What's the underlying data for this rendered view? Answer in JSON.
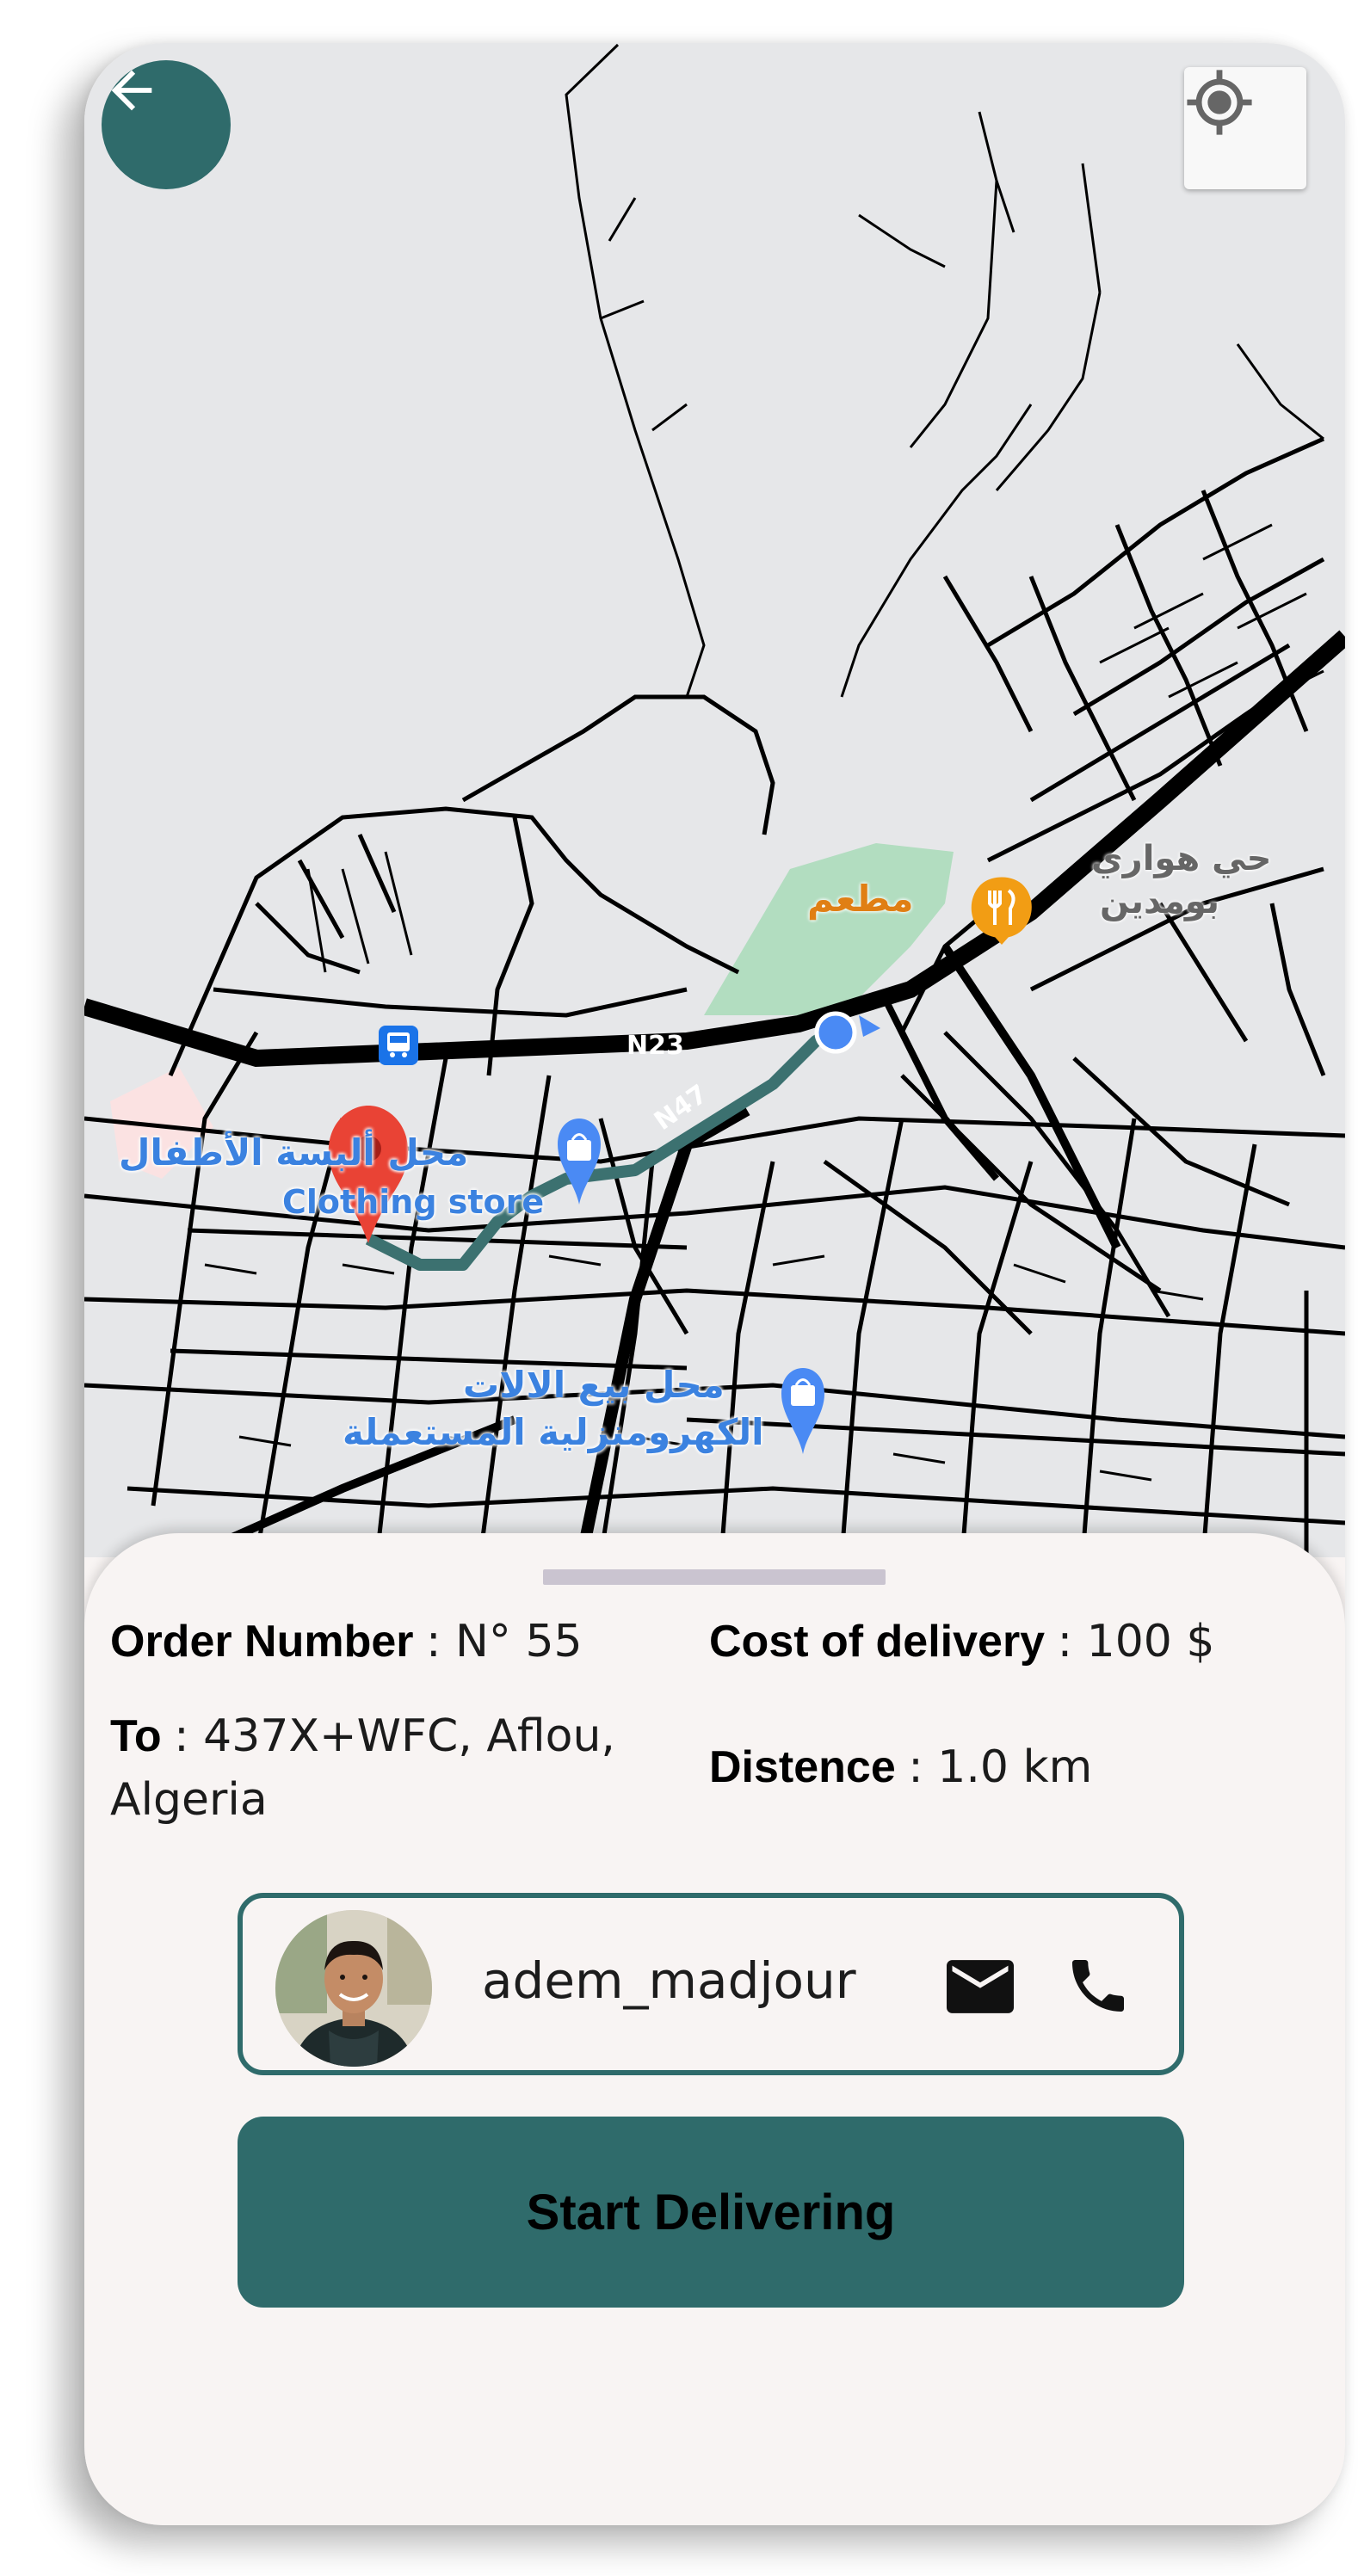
{
  "map": {
    "labels": {
      "clothing_ar": "محل ألبسة الأطفال",
      "clothing_en": "Clothing store",
      "restaurant_ar": "مطعم",
      "district_ar_1": "حي هواري",
      "district_ar_2": "بومدين",
      "electronics_ar_1": "محل بيع الالات",
      "electronics_ar_2": "الكهرومنزلية المستعملة",
      "road_n23": "N23",
      "road_n47": "N47"
    },
    "icons": {
      "back": "arrow-left-icon",
      "locate": "my-location-icon",
      "destination": "map-pin-icon",
      "shopping": "shopping-bag-icon",
      "restaurant": "restaurant-icon",
      "bus": "bus-icon"
    },
    "colors": {
      "route": "#3c7170",
      "pin": "#e94335",
      "poi_blue": "#4a8af4",
      "poi_orange": "#f29d14",
      "park": "#b2ddc0"
    }
  },
  "order": {
    "number_label": "Order Number",
    "number_value": ": N° 55",
    "cost_label": "Cost of  delivery",
    "cost_value": ": 100 $",
    "to_label": "To",
    "to_value_line1": ":  437X+WFC, Aflou,",
    "to_value_line2": "Algeria",
    "distance_label": "Distence",
    "distance_value": ": 1.0 km"
  },
  "customer": {
    "username": "adem_madjour",
    "mail_icon": "mail-icon",
    "phone_icon": "phone-icon"
  },
  "actions": {
    "start_label": "Start Delivering"
  },
  "colors": {
    "primary": "#2f6b6b",
    "sheet_bg": "#f8f4f3",
    "handle": "#cac4d0"
  }
}
